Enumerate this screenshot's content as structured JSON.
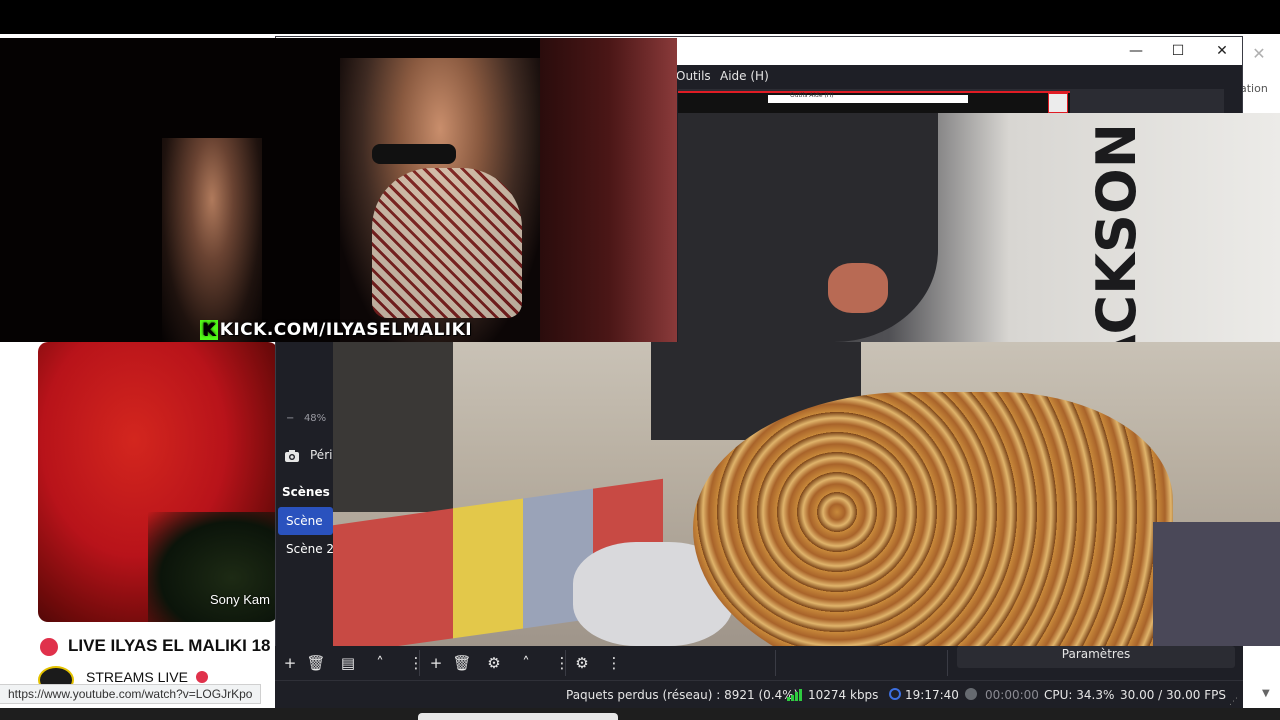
{
  "browser": {
    "thumbnail_caption": "Sony Kam",
    "video_title": "LIVE ILYAS EL MALIKI 18",
    "channel_name": "STREAMS LIVE",
    "status_url": "https://www.youtube.com/watch?v=LOGJrKpo",
    "side_text": "ation"
  },
  "guest_video": {
    "watermark": "KICK.COM/ILYASELMALIKI",
    "watermark_k": "K"
  },
  "obs": {
    "window_controls": {
      "minimize": "—",
      "maximize": "☐",
      "close": "✕"
    },
    "menu": [
      "Outils",
      "Aide (H)"
    ],
    "zoom_label": "48%",
    "zoom_minus": "−",
    "source_label": "Péri",
    "scenes_title": "Scènes",
    "scenes": [
      "Scène",
      "Scène 2"
    ],
    "settings_button": "Paramètres",
    "status": {
      "dropped_frames": "Paquets perdus (réseau) : 8921 (0.4%)",
      "bitrate": "10274 kbps",
      "stream_time": "19:17:40",
      "record_time": "00:00:00",
      "cpu": "CPU: 34.3%",
      "fps": "30.00 / 30.00 FPS"
    },
    "nested_preview_text": "Outils  Aide (H)"
  },
  "webcam": {
    "poster_text": "ACKSON"
  },
  "colors": {
    "obs_bg": "#1e1f26",
    "scene_selected": "#2a52be",
    "live_red": "#e0314b",
    "kick_green": "#53fc18",
    "signal_green": "#2ecc40"
  }
}
